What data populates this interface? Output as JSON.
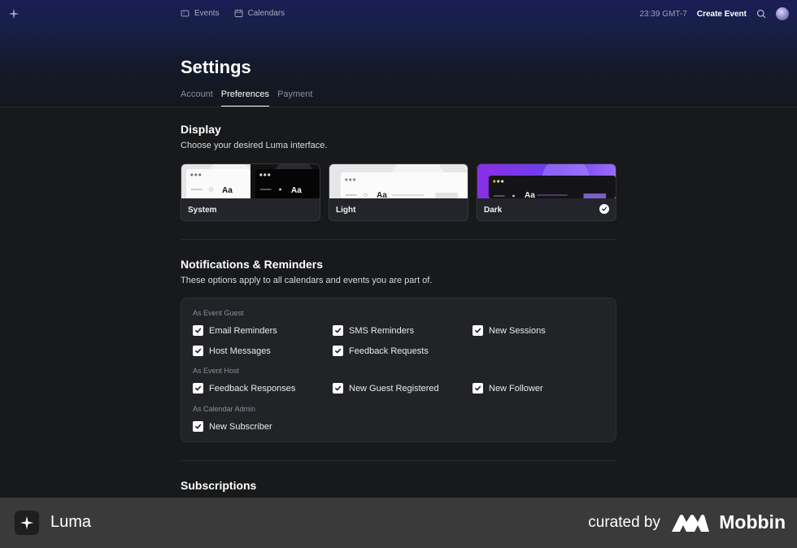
{
  "nav": {
    "events": "Events",
    "calendars": "Calendars",
    "time": "23:39 GMT-7",
    "create_event": "Create Event"
  },
  "page": {
    "title": "Settings",
    "tabs": [
      {
        "label": "Account",
        "active": false
      },
      {
        "label": "Preferences",
        "active": true
      },
      {
        "label": "Payment",
        "active": false
      }
    ]
  },
  "display": {
    "title": "Display",
    "subtitle": "Choose your desired Luma interface.",
    "preview_text": "Aa",
    "themes": [
      {
        "label": "System",
        "selected": false
      },
      {
        "label": "Light",
        "selected": false
      },
      {
        "label": "Dark",
        "selected": true
      }
    ]
  },
  "notifications": {
    "title": "Notifications & Reminders",
    "subtitle": "These options apply to all calendars and events you are part of.",
    "groups": [
      {
        "label": "As Event Guest",
        "options": [
          {
            "label": "Email Reminders",
            "checked": true
          },
          {
            "label": "SMS Reminders",
            "checked": true
          },
          {
            "label": "New Sessions",
            "checked": true
          },
          {
            "label": "Host Messages",
            "checked": true
          },
          {
            "label": "Feedback Requests",
            "checked": true
          }
        ]
      },
      {
        "label": "As Event Host",
        "options": [
          {
            "label": "Feedback Responses",
            "checked": true
          },
          {
            "label": "New Guest Registered",
            "checked": true
          },
          {
            "label": "New Follower",
            "checked": true
          }
        ]
      },
      {
        "label": "As Calendar Admin",
        "options": [
          {
            "label": "New Subscriber",
            "checked": true
          }
        ]
      }
    ]
  },
  "subscriptions": {
    "title": "Subscriptions"
  },
  "footer": {
    "app_name": "Luma",
    "curated_by": "curated by",
    "brand": "Mobbin"
  },
  "colors": {
    "accent_dark_theme": "#7b3ff2",
    "background": "#18191b",
    "card": "#212327"
  }
}
